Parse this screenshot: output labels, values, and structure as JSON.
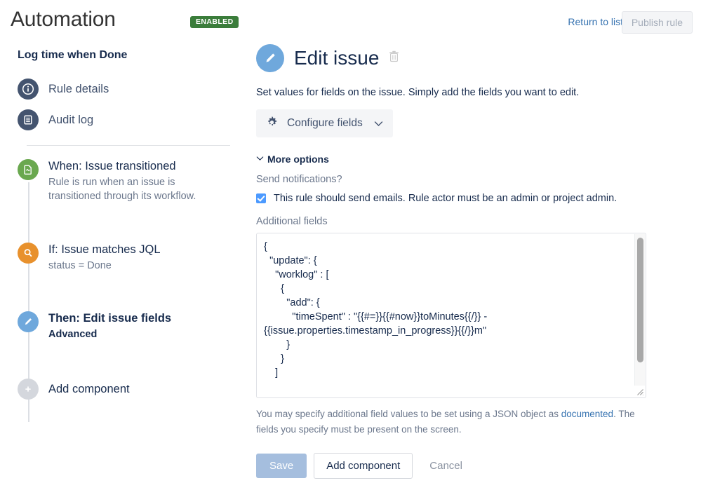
{
  "header": {
    "app_title": "Automation",
    "status_badge": "ENABLED",
    "return_link": "Return to list",
    "publish_button": "Publish rule"
  },
  "sidebar": {
    "rule_name": "Log time when Done",
    "nav_items": [
      {
        "label": "Rule details",
        "icon": "info-icon"
      },
      {
        "label": "Audit log",
        "icon": "document-list-icon"
      }
    ],
    "components": [
      {
        "title": "When: Issue transitioned",
        "subtitle": "Rule is run when an issue is transitioned through its workflow.",
        "icon": "transition-icon"
      },
      {
        "title": "If: Issue matches JQL",
        "subtitle": "status = Done",
        "icon": "search-icon"
      },
      {
        "title": "Then: Edit issue fields",
        "subtitle": "Advanced",
        "icon": "pencil-icon"
      }
    ],
    "add_component": "Add component"
  },
  "main": {
    "title": "Edit issue",
    "delete_icon": "trash-icon",
    "description": "Set values for fields on the issue. Simply add the fields you want to edit.",
    "configure_fields_button": "Configure fields",
    "more_options_label": "More options",
    "send_notifications_label": "Send notifications?",
    "send_emails_checkbox_label": "This rule should send emails. Rule actor must be an admin or project admin.",
    "send_emails_checked": true,
    "additional_fields_label": "Additional fields",
    "additional_fields_value": "{\n  \"update\": {\n    \"worklog\" : [\n      {\n        \"add\": {\n          \"timeSpent\" : \"{{#=}}{{#now}}toMinutes{{/}} - {{issue.properties.timestamp_in_progress}}{{/}}m\"\n        }\n      }\n    ]",
    "help_text_before": "You may specify additional field values to be set using a JSON object as ",
    "help_link": "documented",
    "help_text_after": ". The fields you specify must be present on the screen.",
    "save_button": "Save",
    "add_component_button": "Add component",
    "cancel_button": "Cancel"
  },
  "colors": {
    "enabled_badge": "#3b7d3b",
    "link": "#3572b0",
    "trigger_green": "#6aa84f",
    "condition_orange": "#e8912d",
    "action_blue": "#6fa8dc",
    "nav_navy": "#44546f",
    "checkbox_blue": "#4c9aff"
  }
}
